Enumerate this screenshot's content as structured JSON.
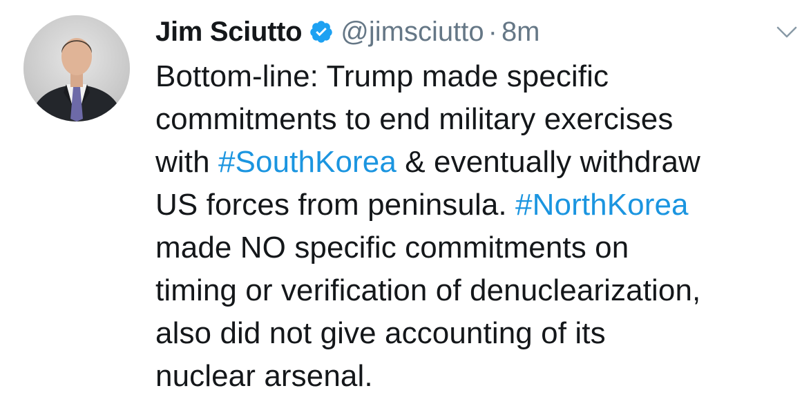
{
  "author": {
    "display_name": "Jim Sciutto",
    "handle": "@jimsciutto",
    "separator": "·",
    "time": "8m",
    "verified": true
  },
  "icons": {
    "verified": "verified-badge-icon",
    "caret": "chevron-down-icon"
  },
  "colors": {
    "text": "#14171a",
    "secondary": "#657786",
    "link": "#1b95e0",
    "verified": "#1da1f2"
  },
  "tweet": {
    "lines": [
      [
        "Bottom-line: Trump made specific"
      ],
      [
        "commitments to end military exercises"
      ],
      [
        "with ",
        "#SouthKorea",
        " & eventually withdraw"
      ],
      [
        "US forces from peninsula. ",
        "#NorthKorea"
      ],
      [
        "made NO specific commitments on"
      ],
      [
        "timing or verification of denuclearization,"
      ],
      [
        "also did not give accounting of its"
      ],
      [
        "nuclear arsenal."
      ]
    ],
    "hashtags": [
      "#SouthKorea",
      "#NorthKorea"
    ]
  }
}
